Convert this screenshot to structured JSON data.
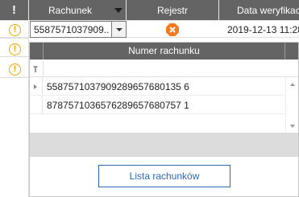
{
  "grid": {
    "header": {
      "mark": "!",
      "rachunek": "Rachunek",
      "rejestr": "Rejestr",
      "data_weryfikacji": "Data weryfikacji"
    },
    "row": {
      "account": "5587571037909...",
      "date": "2019-12-13 11:28:"
    }
  },
  "warnings": [
    "!",
    "!",
    "!"
  ],
  "colors": {
    "header_bg": "#646464",
    "warning": "#f0a500",
    "status_x": "#f47a1f",
    "accent": "#2d6ab8"
  },
  "dropdown": {
    "header": "Numer rachunku",
    "rows": [
      "5587571037909289657680135 6",
      "8787571036576289657680757 1"
    ],
    "button_label": "Lista rachunków"
  }
}
